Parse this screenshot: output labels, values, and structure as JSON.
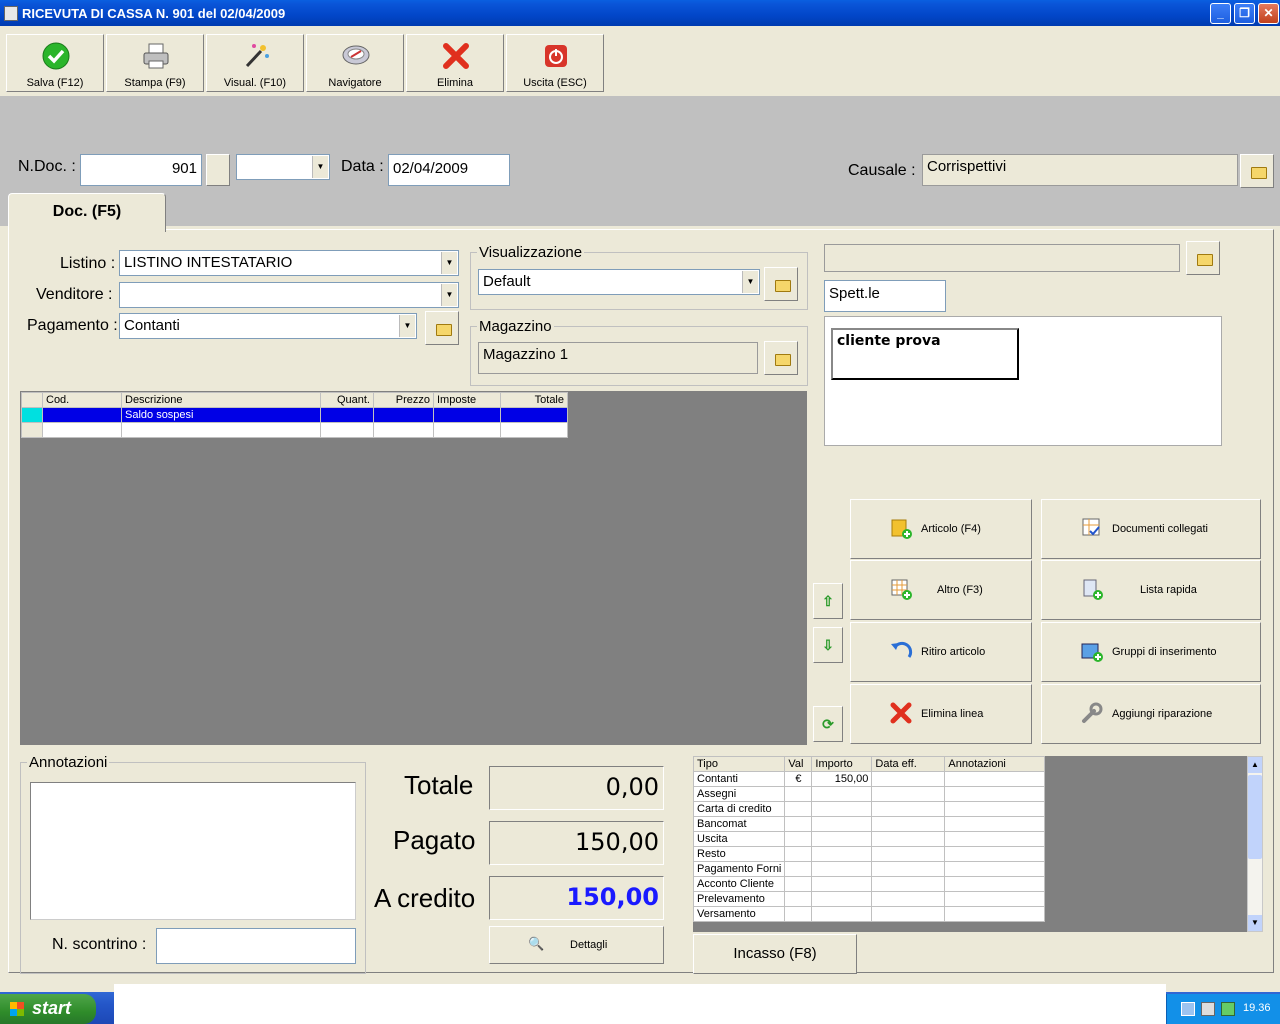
{
  "window": {
    "title": "RICEVUTA DI CASSA N.  901   del 02/04/2009"
  },
  "toolbar": [
    {
      "label": "Salva (F12)",
      "icon": "check-icon"
    },
    {
      "label": "Stampa (F9)",
      "icon": "printer-icon"
    },
    {
      "label": "Visual. (F10)",
      "icon": "magic-wand-icon"
    },
    {
      "label": "Navigatore",
      "icon": "compass-icon"
    },
    {
      "label": "Elimina",
      "icon": "delete-x-icon"
    },
    {
      "label": "Uscita (ESC)",
      "icon": "power-icon"
    }
  ],
  "header": {
    "ndoc_label": "N.Doc. :",
    "ndoc_value": "901",
    "data_label": "Data :",
    "data_value": "02/04/2009",
    "causale_label": "Causale :",
    "causale_value": "Corrispettivi"
  },
  "tab": {
    "label": "Doc. (F5)"
  },
  "form": {
    "listino_label": "Listino :",
    "listino_value": "LISTINO INTESTATARIO",
    "venditore_label": "Venditore :",
    "venditore_value": "",
    "pagamento_label": "Pagamento :",
    "pagamento_value": "Contanti",
    "visualizzazione_legend": "Visualizzazione",
    "visualizzazione_value": "Default",
    "magazzino_legend": "Magazzino",
    "magazzino_value": "Magazzino 1"
  },
  "customer": {
    "title_value": "Spett.le",
    "name": "cliente prova"
  },
  "items": {
    "columns": [
      "Cod.",
      "Descrizione",
      "Quant.",
      "Prezzo",
      "Imposte",
      "Totale"
    ],
    "rows": [
      [
        "",
        "Saldo sospesi",
        "",
        "",
        "",
        ""
      ]
    ]
  },
  "actions": [
    {
      "label": "Articolo (F4)",
      "icon": "box-add-icon"
    },
    {
      "label": "Documenti collegati",
      "icon": "linked-docs-icon"
    },
    {
      "label": "Altro (F3)",
      "icon": "grid-add-icon"
    },
    {
      "label": "Lista rapida",
      "icon": "quick-list-icon"
    },
    {
      "label": "Ritiro articolo",
      "icon": "undo-arrow-icon"
    },
    {
      "label": "Gruppi di inserimento",
      "icon": "group-insert-icon"
    },
    {
      "label": "Elimina linea",
      "icon": "delete-x-icon"
    },
    {
      "label": "Aggiungi riparazione",
      "icon": "wrench-icon"
    }
  ],
  "notes": {
    "legend": "Annotazioni",
    "scontrino_label": "N. scontrino :",
    "scontrino_value": ""
  },
  "totals": {
    "totale_label": "Totale",
    "totale_value": "0,00",
    "pagato_label": "Pagato",
    "pagato_value": "150,00",
    "credito_label": "A credito",
    "credito_value": "150,00",
    "credito_color": "#1a1aff",
    "dettagli_label": "Dettagli"
  },
  "payments": {
    "columns": [
      "Tipo",
      "Val",
      "Importo",
      "Data eff.",
      "Annotazioni"
    ],
    "rows": [
      [
        "Contanti",
        "€",
        "150,00",
        "",
        ""
      ],
      [
        "Assegni",
        "",
        "",
        "",
        ""
      ],
      [
        "Carta di credito",
        "",
        "",
        "",
        ""
      ],
      [
        "Bancomat",
        "",
        "",
        "",
        ""
      ],
      [
        "Uscita",
        "",
        "",
        "",
        ""
      ],
      [
        "Resto",
        "",
        "",
        "",
        ""
      ],
      [
        "Pagamento Forni",
        "",
        "",
        "",
        ""
      ],
      [
        "Acconto Cliente",
        "",
        "",
        "",
        ""
      ],
      [
        "Prelevamento",
        "",
        "",
        "",
        ""
      ],
      [
        "Versamento",
        "",
        "",
        "",
        ""
      ]
    ],
    "incasso_label": "Incasso (F8)"
  },
  "taskbar": {
    "start_label": "start",
    "clock": "19.36"
  }
}
